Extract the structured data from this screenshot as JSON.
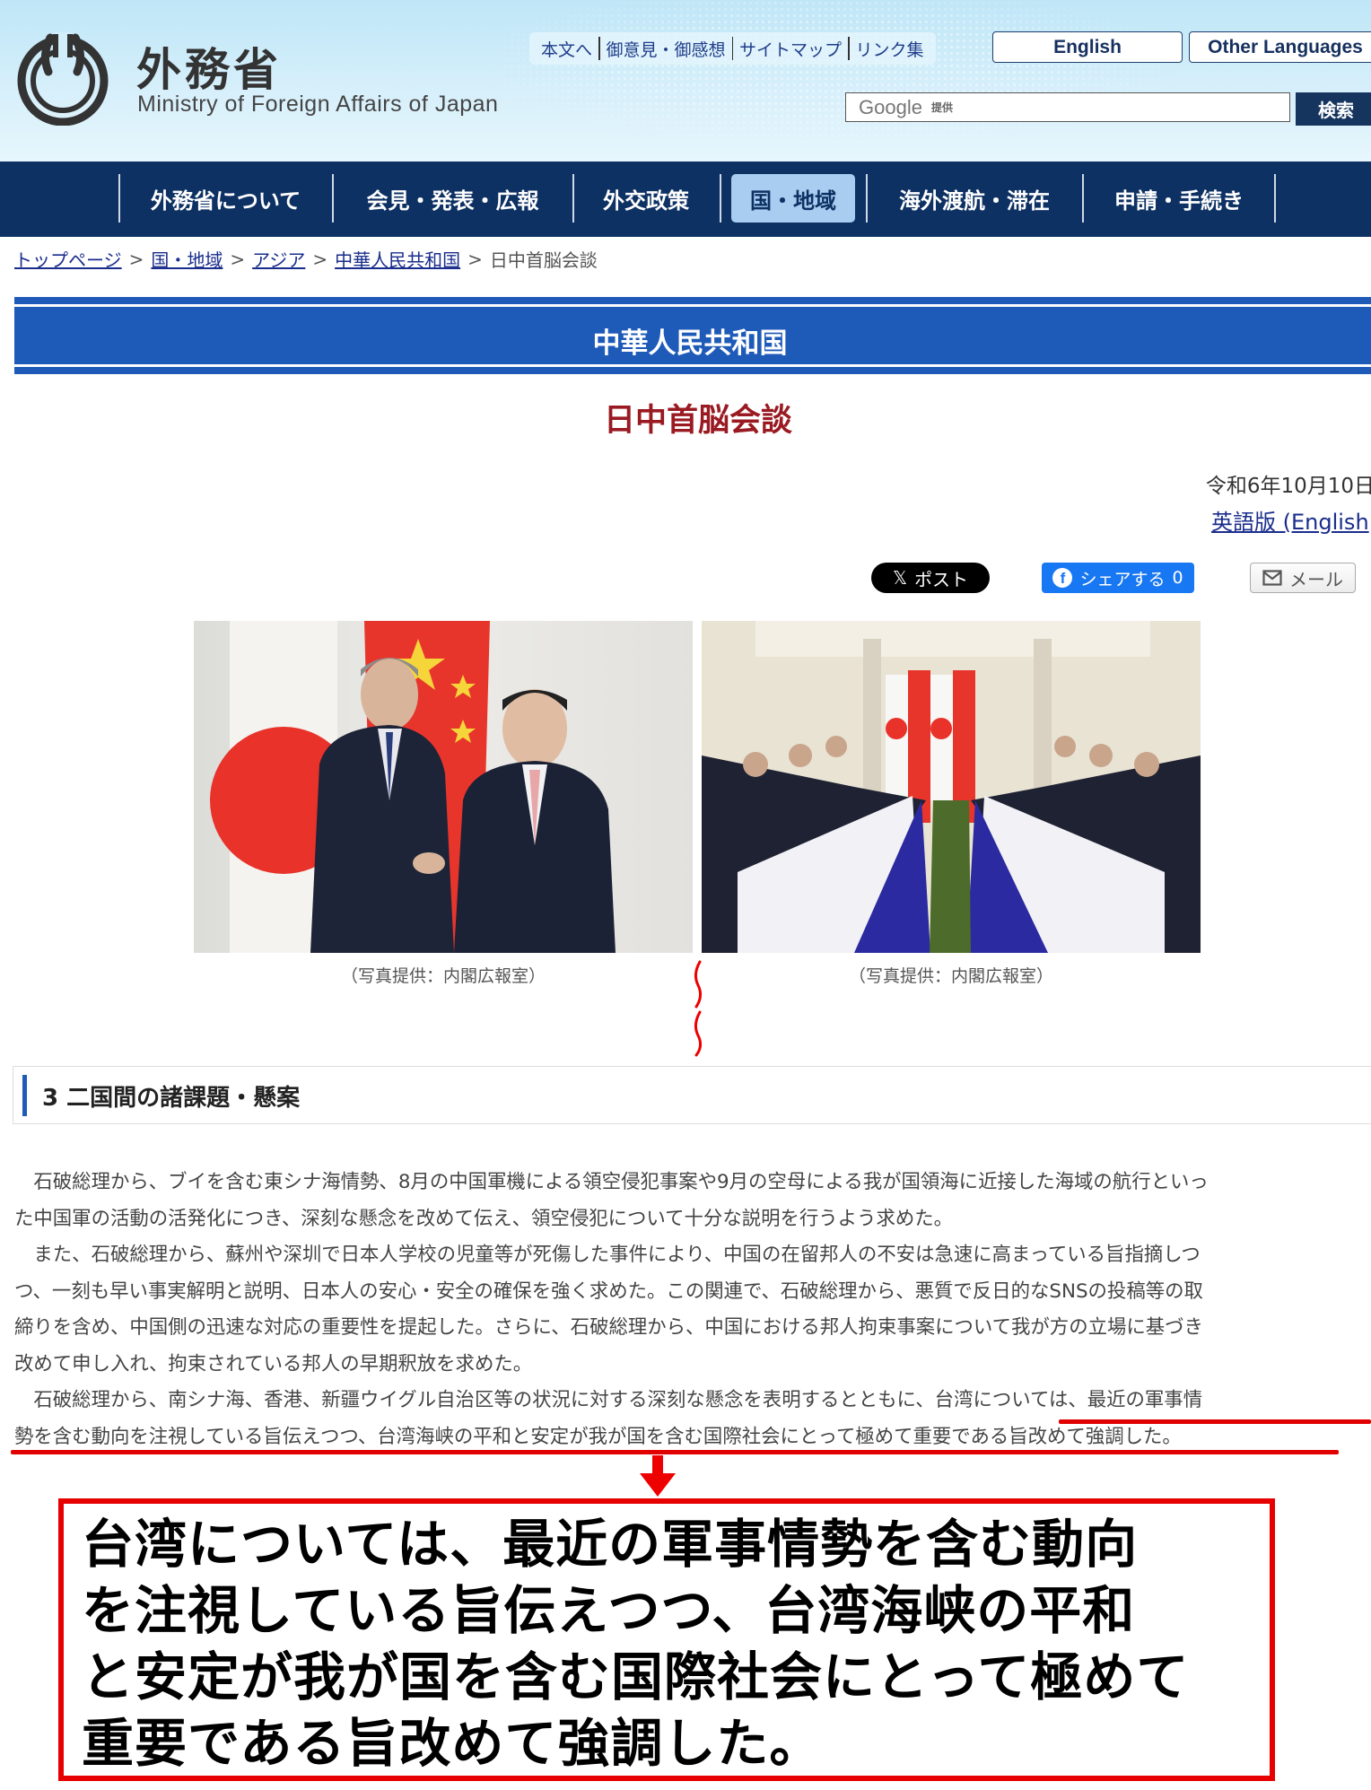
{
  "header": {
    "org_name_ja": "外務省",
    "org_name_en": "Ministry of Foreign Affairs of Japan",
    "utility_links": [
      "本文へ",
      "御意見・御感想",
      "サイトマップ",
      "リンク集"
    ],
    "language_buttons": [
      "English",
      "Other Languages"
    ],
    "search": {
      "placeholder_brand": "Google",
      "placeholder_suffix": "提供",
      "value": "",
      "button_label": "検索"
    }
  },
  "nav": {
    "items": [
      {
        "label": "外務省について",
        "active": false
      },
      {
        "label": "会見・発表・広報",
        "active": false
      },
      {
        "label": "外交政策",
        "active": false
      },
      {
        "label": "国・地域",
        "active": true
      },
      {
        "label": "海外渡航・滞在",
        "active": false
      },
      {
        "label": "申請・手続き",
        "active": false
      }
    ],
    "active_bg": "#a8cdf0",
    "bar_color": "#0e3163"
  },
  "breadcrumb": {
    "links": [
      "トップページ",
      "国・地域",
      "アジア",
      "中華人民共和国"
    ],
    "current": "日中首脳会談",
    "separator": ">"
  },
  "country_banner": {
    "title": "中華人民共和国",
    "color": "#1e5ab8"
  },
  "page_title": "日中首脳会談",
  "date": "令和6年10月10日",
  "english_version_link": "英語版 (English",
  "share": {
    "x_label": "ポスト",
    "x_glyph": "𝕏",
    "facebook_label": "シェアする",
    "facebook_count": "0",
    "mail_label": "メール"
  },
  "photos": [
    {
      "alt": "両首脳の握手",
      "caption": "（写真提供：内閣広報室）"
    },
    {
      "alt": "会談の様子",
      "caption": "（写真提供：内閣広報室）"
    }
  ],
  "section": {
    "number": "3",
    "title": "二国間の諸課題・懸案",
    "lines": [
      "　石破総理から、ブイを含む東シナ海情勢、8月の中国軍機による領空侵犯事案や9月の空母による我が国領海に近接した海域の航行といっ",
      "た中国軍の活動の活発化につき、深刻な懸念を改めて伝え、領空侵犯について十分な説明を行うよう求めた。",
      "　また、石破総理から、蘇州や深圳で日本人学校の児童等が死傷した事件により、中国の在留邦人の不安は急速に高まっている旨指摘しつ",
      "つ、一刻も早い事実解明と説明、日本人の安心・安全の確保を強く求めた。この関連で、石破総理から、悪質で反日的なSNSの投稿等の取",
      "締りを含め、中国側の迅速な対応の重要性を提起した。さらに、石破総理から、中国における邦人拘束事案について我が方の立場に基づき",
      "改めて申し入れ、拘束されている邦人の早期釈放を求めた。",
      "　石破総理から、南シナ海、香港、新疆ウイグル自治区等の状況に対する深刻な懸念を表明するとともに、台湾については、最近の軍事情",
      "勢を含む動向を注視している旨伝えつつ、台湾海峡の平和と安定が我が国を含む国際社会にとって極めて重要である旨改めて強調した。"
    ]
  },
  "annotation": {
    "highlight_color": "#e60000",
    "quote_lines": [
      "台湾については、最近の軍事情勢を含む動向",
      "を注視している旨伝えつつ、台湾海峡の平和",
      "と安定が我が国を含む国際社会にとって極めて",
      "重要である旨改めて強調した。"
    ]
  }
}
